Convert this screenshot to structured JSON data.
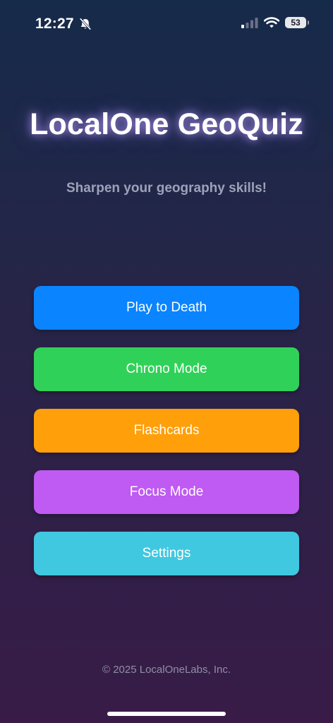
{
  "status_bar": {
    "time": "12:27",
    "battery_level": "53",
    "icons": [
      "bell-slash-icon",
      "cellular-signal-icon",
      "wifi-icon",
      "battery-icon"
    ]
  },
  "header": {
    "title": "LocalOne GeoQuiz",
    "subtitle": "Sharpen your geography skills!"
  },
  "menu": {
    "items": [
      {
        "label": "Play to Death",
        "color": "#0a84ff"
      },
      {
        "label": "Chrono Mode",
        "color": "#30d158"
      },
      {
        "label": "Flashcards",
        "color": "#ff9f0a"
      },
      {
        "label": "Focus Mode",
        "color": "#bf5af2"
      },
      {
        "label": "Settings",
        "color": "#40c8e0"
      }
    ]
  },
  "footer": {
    "copyright": "© 2025 LocalOneLabs, Inc."
  },
  "colors": {
    "background_top": "#162a4a",
    "background_bottom": "#381c47",
    "title_glow": "#b9a0ff",
    "subtitle": "#9ea2b8",
    "footer_text": "#8e90a6"
  }
}
